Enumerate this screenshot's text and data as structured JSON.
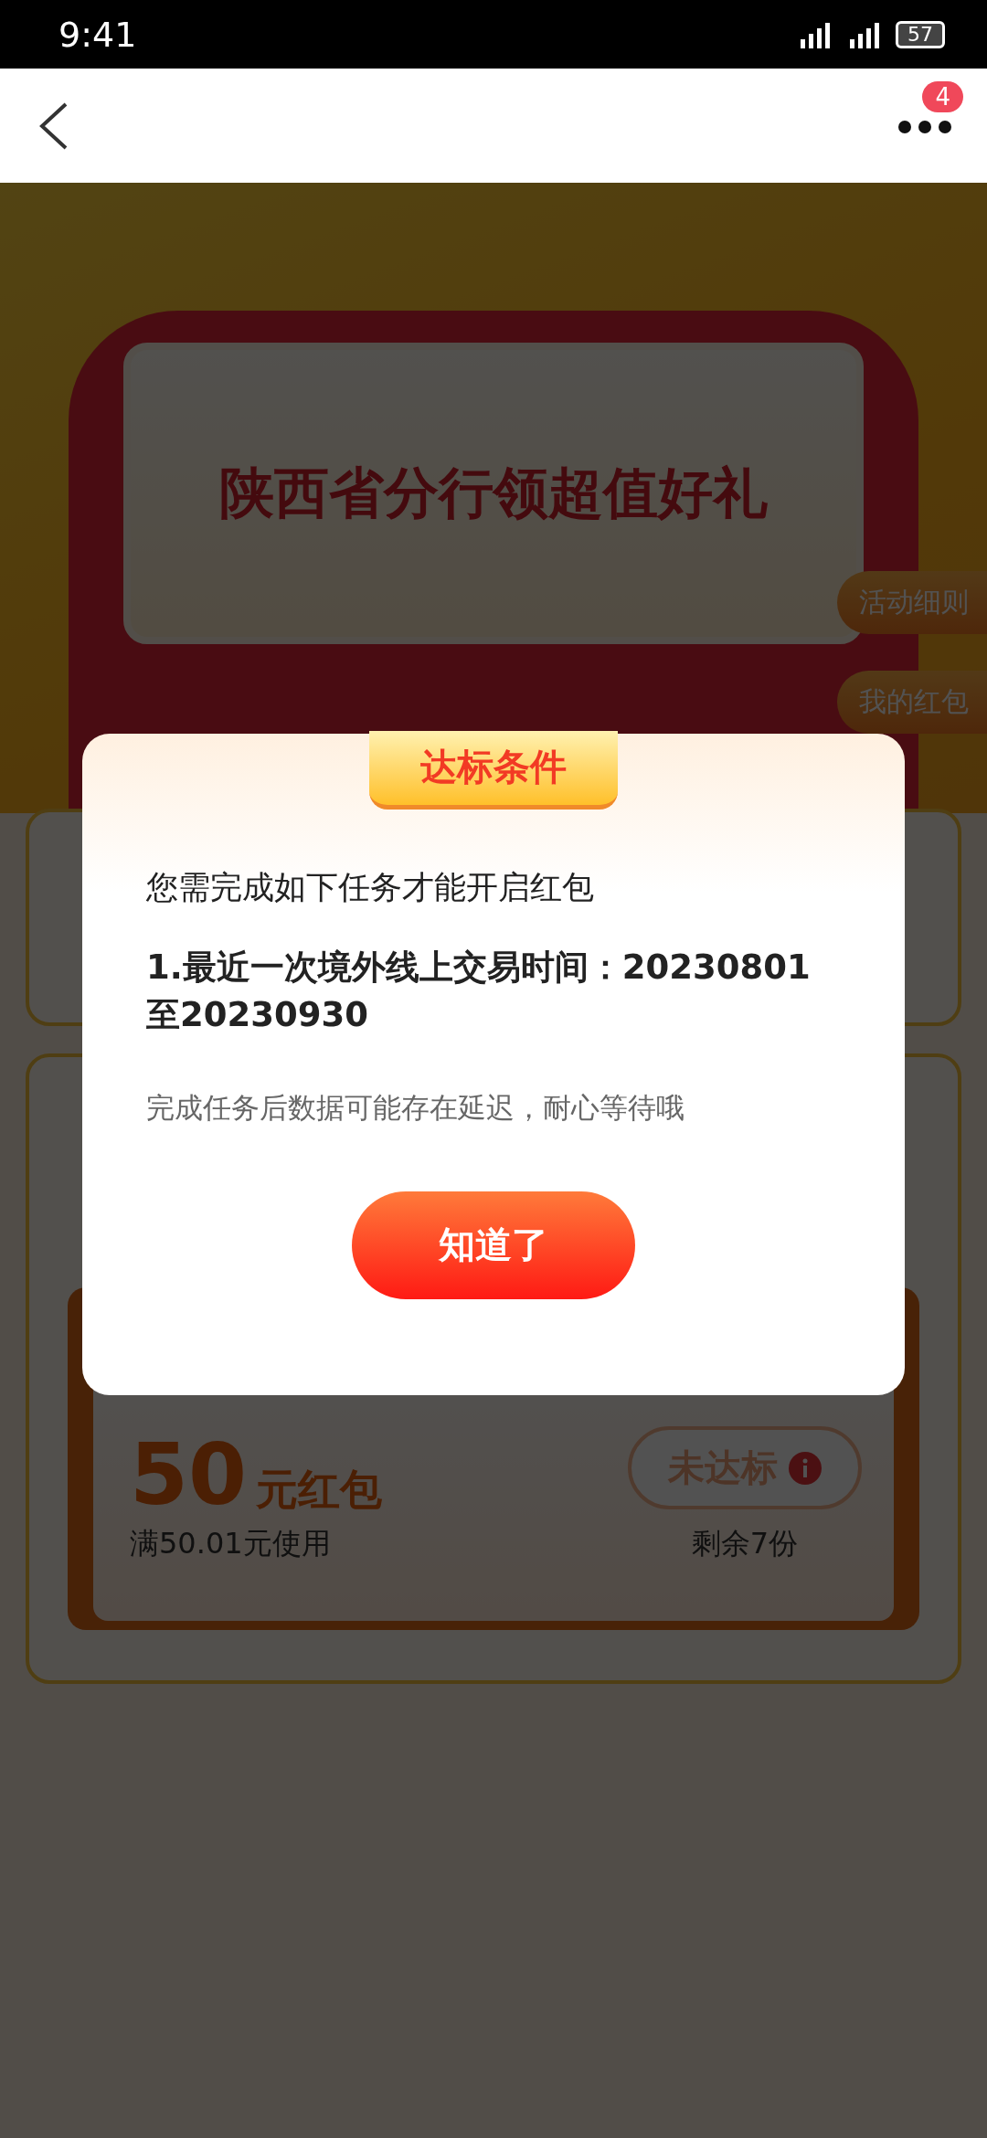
{
  "status_bar": {
    "time": "9:41",
    "battery": "57"
  },
  "header": {
    "badge": "4"
  },
  "banner": {
    "title": "陕西省分行领超值好礼"
  },
  "side_buttons": [
    "活动细则",
    "我的红包"
  ],
  "coupon": {
    "amount": "50",
    "unit": "元红包",
    "condition": "满50.01元使用",
    "status": "未达标",
    "remaining": "剩余7份"
  },
  "dialog": {
    "title": "达标条件",
    "intro": "您需完成如下任务才能开启红包",
    "task": "1.最近一次境外线上交易时间：20230801至20230930",
    "note": "完成任务后数据可能存在延迟，耐心等待哦",
    "button": "知道了"
  }
}
